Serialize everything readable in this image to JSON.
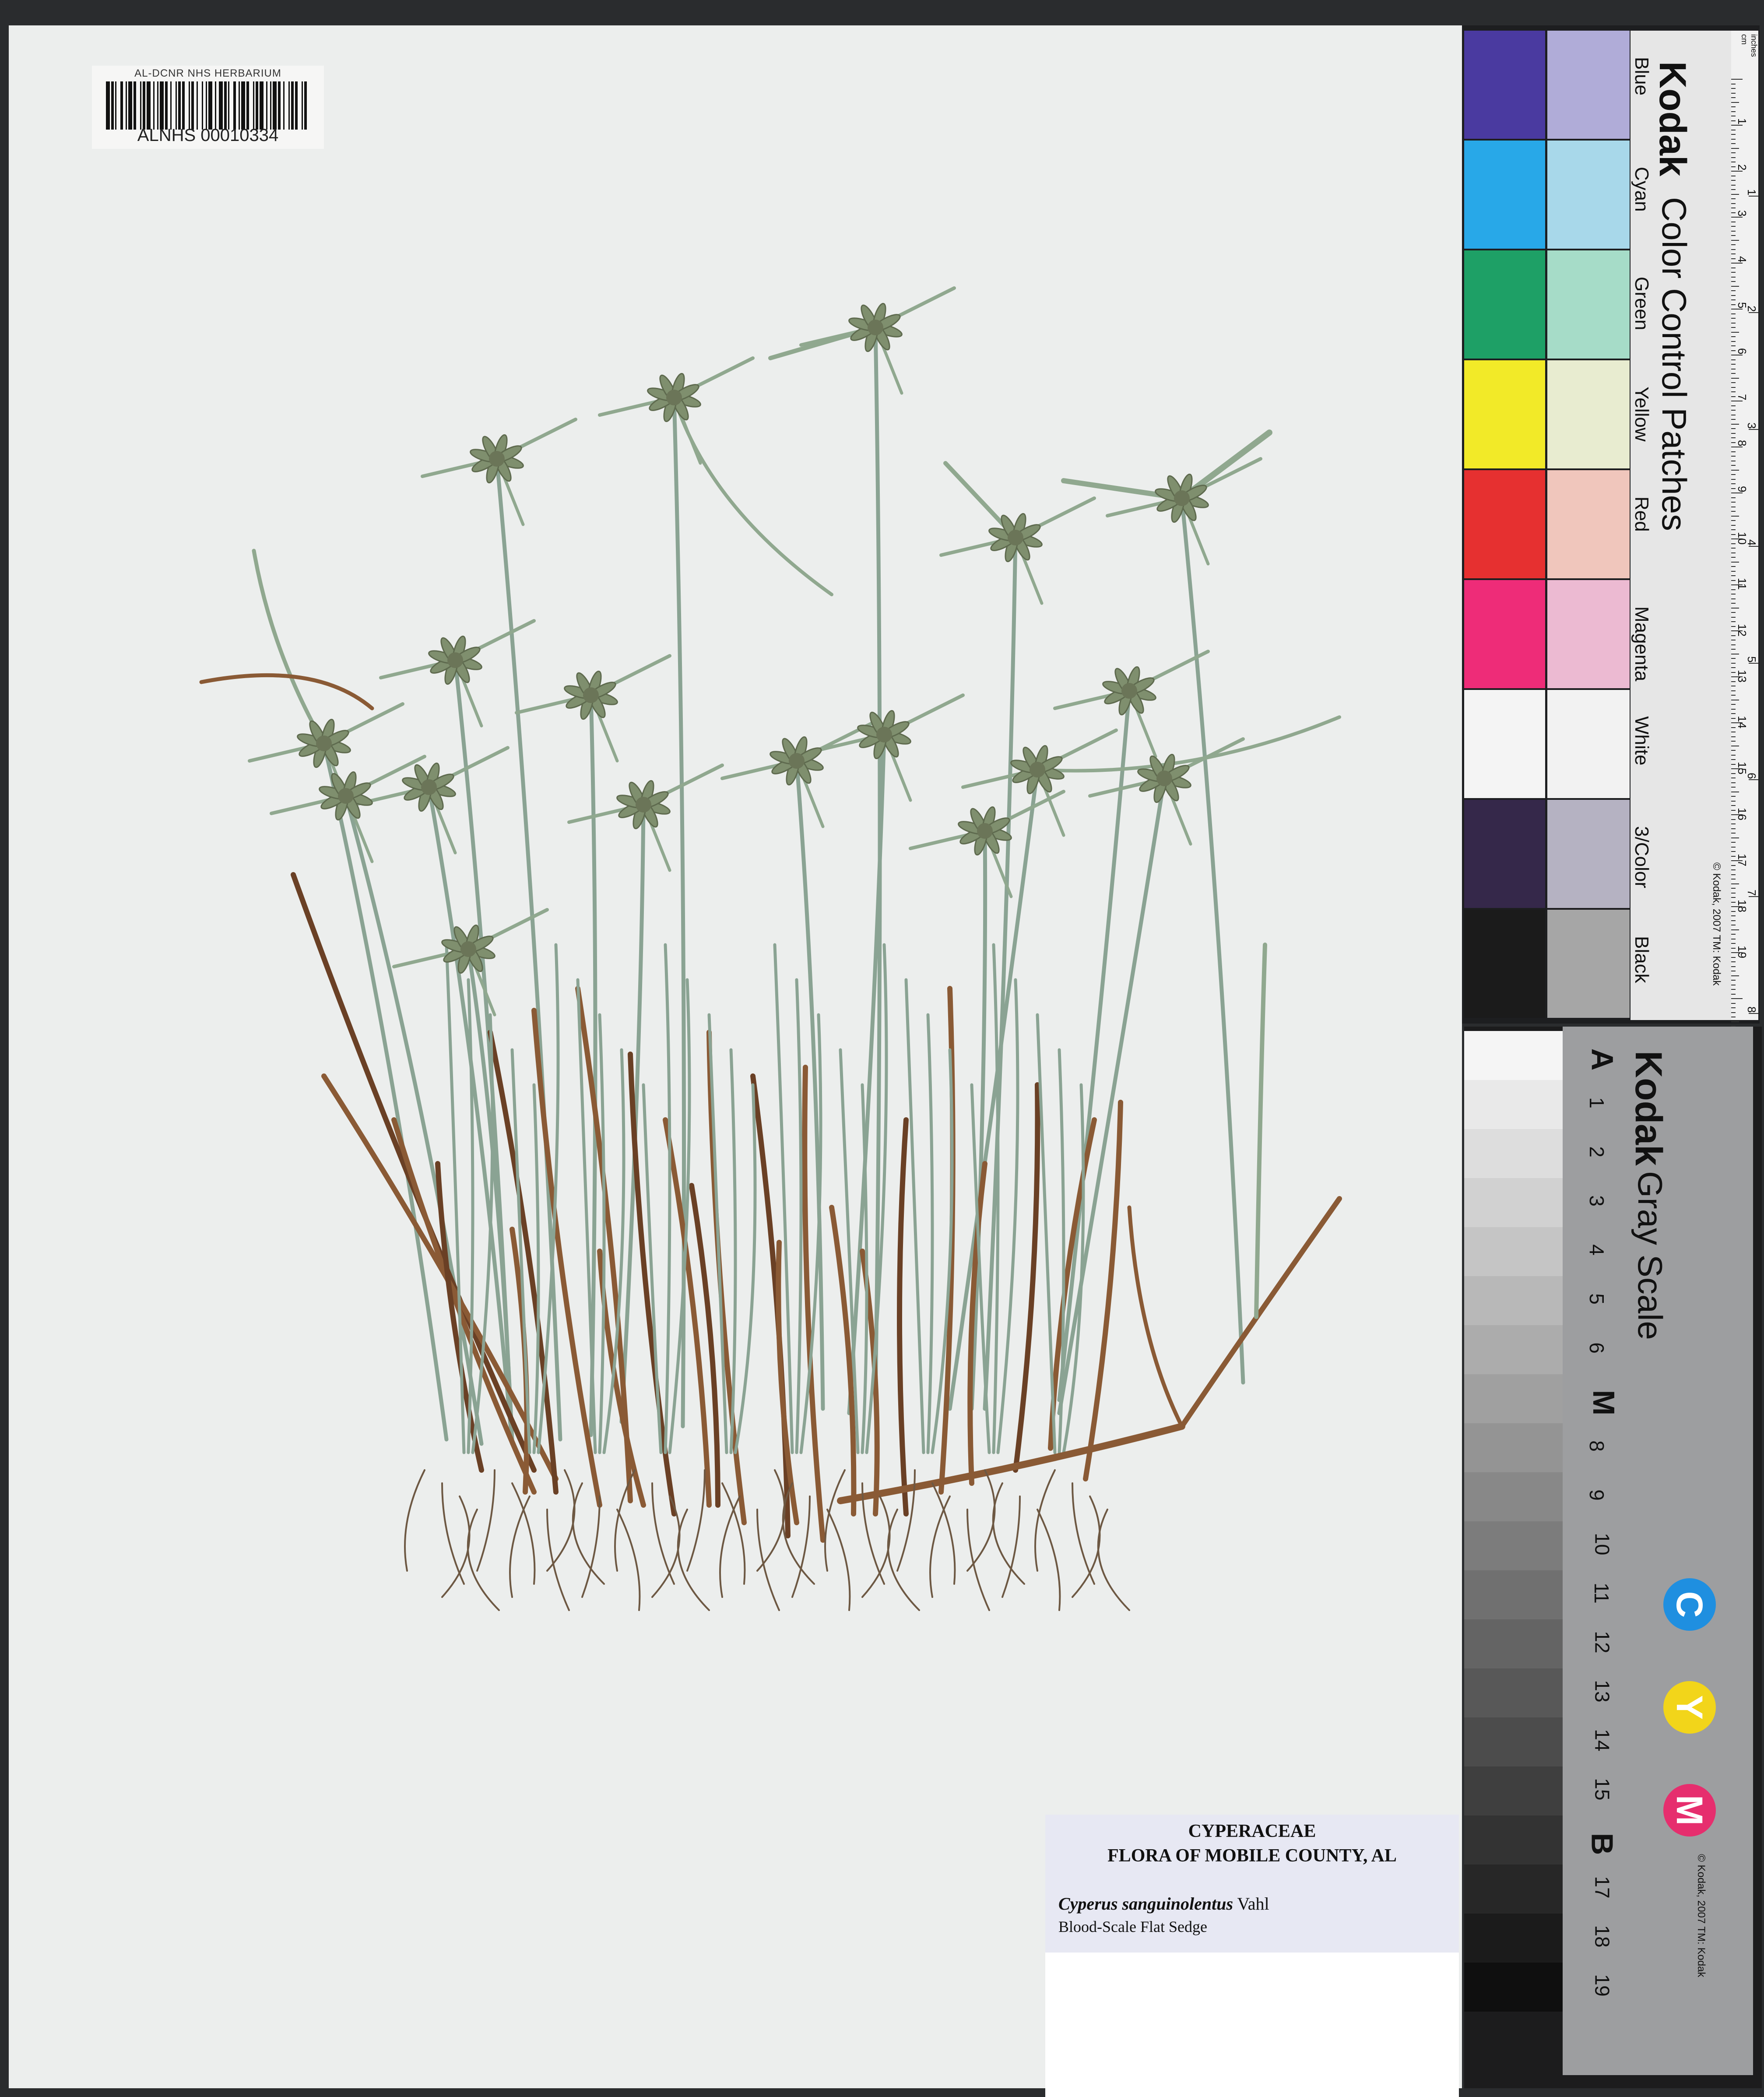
{
  "barcode": {
    "institution": "AL-DCNR NHS HERBARIUM",
    "catalog_number": "ALNHS 00010334"
  },
  "label": {
    "family": "CYPERACEAE",
    "flora": "FLORA OF MOBILE COUNTY, AL",
    "scientific_name": "Cyperus sanguinolentus",
    "authority": "Vahl",
    "common_name": "Blood-Scale Flat Sedge"
  },
  "color_card": {
    "brand": "Kodak",
    "title": "Color Control Patches",
    "copyright": "© Kodak, 2007 TM: Kodak",
    "ruler_units": [
      "cm",
      "inches"
    ],
    "cm_ticks": [
      "1",
      "2",
      "3",
      "4",
      "5",
      "6",
      "7",
      "8",
      "9",
      "10",
      "11",
      "12",
      "13",
      "14",
      "15",
      "16",
      "17",
      "18",
      "19"
    ],
    "inch_ticks": [
      "1",
      "2",
      "3",
      "4",
      "5",
      "6",
      "7",
      "8"
    ],
    "patches": [
      {
        "name": "Blue",
        "color": "#4a3aa0",
        "tint": "#b0acd8"
      },
      {
        "name": "Cyan",
        "color": "#28a8e8",
        "tint": "#a8d8ea"
      },
      {
        "name": "Green",
        "color": "#1ea066",
        "tint": "#a6dcc8"
      },
      {
        "name": "Yellow",
        "color": "#f2ea28",
        "tint": "#e8ecd0"
      },
      {
        "name": "Red",
        "color": "#e63030",
        "tint": "#f0c6bc"
      },
      {
        "name": "Magenta",
        "color": "#ee2c78",
        "tint": "#ecbad2"
      },
      {
        "name": "White",
        "color": "#f4f4f4",
        "tint": "#f2f2f2"
      },
      {
        "name": "3/Color",
        "color": "#35284a",
        "tint": "#b5b2c2"
      },
      {
        "name": "Black",
        "color": "#1b1b1b",
        "tint": "#a6a6a6"
      }
    ]
  },
  "gray_card": {
    "brand": "Kodak",
    "title": "Gray Scale",
    "copyright": "© Kodak, 2007 TM: Kodak",
    "steps": [
      "A",
      "1",
      "2",
      "3",
      "4",
      "5",
      "6",
      "M",
      "8",
      "9",
      "10",
      "11",
      "12",
      "13",
      "14",
      "15",
      "B",
      "17",
      "18",
      "19"
    ],
    "cmy": [
      {
        "letter": "C",
        "color": "#1f8fe0"
      },
      {
        "letter": "Y",
        "color": "#f2d51a"
      },
      {
        "letter": "M",
        "color": "#e62e6e"
      }
    ]
  }
}
